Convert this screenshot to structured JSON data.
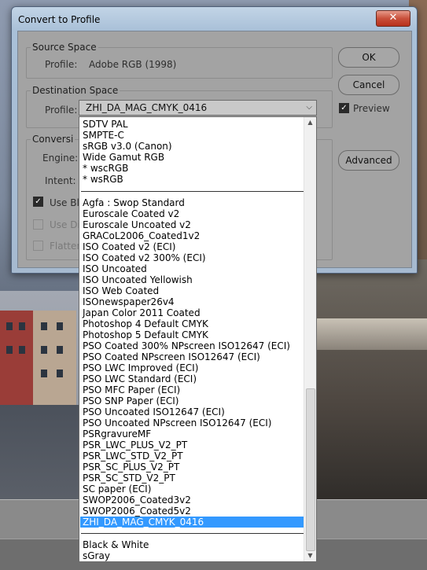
{
  "window": {
    "title": "Convert to Profile",
    "close_glyph": "✕"
  },
  "source": {
    "group_title": "Source Space",
    "profile_label": "Profile:",
    "profile_value": "Adobe RGB (1998)"
  },
  "destination": {
    "group_title": "Destination Space",
    "profile_label": "Profile:",
    "profile_value": "ZHI_DA_MAG_CMYK_0416"
  },
  "conversion": {
    "group_title": "Conversi",
    "engine_label": "Engine:",
    "intent_label": "Intent:",
    "use_black_label": "Use Bl",
    "use_dither_label": "Use Di",
    "flatten_label": "Flatten"
  },
  "buttons": {
    "ok": "OK",
    "cancel": "Cancel",
    "advanced": "Advanced"
  },
  "preview": {
    "label": "Preview",
    "checked": true
  },
  "dropdown": {
    "group1": [
      "SDTV PAL",
      "SMPTE-C",
      "sRGB v3.0 (Canon)",
      "Wide Gamut RGB",
      "* wscRGB",
      "* wsRGB"
    ],
    "group2": [
      "Agfa : Swop Standard",
      "Euroscale Coated v2",
      "Euroscale Uncoated v2",
      "GRACoL2006_Coated1v2",
      "ISO Coated v2 (ECI)",
      "ISO Coated v2 300% (ECI)",
      "ISO Uncoated",
      "ISO Uncoated Yellowish",
      "ISO Web Coated",
      "ISOnewspaper26v4",
      "Japan Color 2011 Coated",
      "Photoshop 4 Default CMYK",
      "Photoshop 5 Default CMYK",
      "PSO Coated 300% NPscreen ISO12647 (ECI)",
      "PSO Coated NPscreen ISO12647 (ECI)",
      "PSO LWC Improved (ECI)",
      "PSO LWC Standard (ECI)",
      "PSO MFC Paper (ECI)",
      "PSO SNP Paper (ECI)",
      "PSO Uncoated ISO12647 (ECI)",
      "PSO Uncoated NPscreen ISO12647 (ECI)",
      "PSRgravureMF",
      "PSR_LWC_PLUS_V2_PT",
      "PSR_LWC_STD_V2_PT",
      "PSR_SC_PLUS_V2_PT",
      "PSR_SC_STD_V2_PT",
      "SC paper (ECI)",
      "SWOP2006_Coated3v2",
      "SWOP2006_Coated5v2",
      "ZHI_DA_MAG_CMYK_0416"
    ],
    "group3": [
      "Black & White",
      "sGray"
    ],
    "selected": "ZHI_DA_MAG_CMYK_0416",
    "selection_color": "#3399ff"
  }
}
